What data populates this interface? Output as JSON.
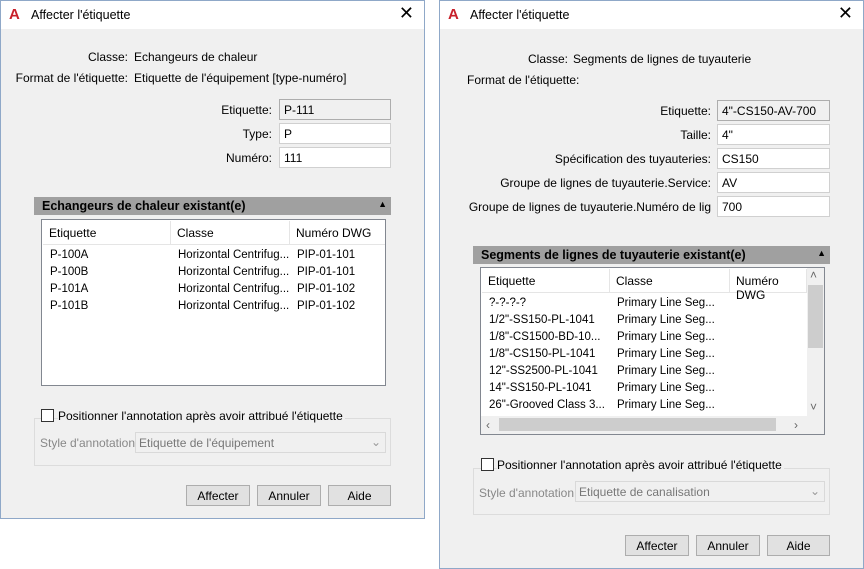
{
  "left": {
    "title": "Affecter l'étiquette",
    "classe_label": "Classe:",
    "classe_value": "Echangeurs de chaleur",
    "format_label": "Format de l'étiquette:",
    "format_value": "Etiquette de l'équipement [type-numéro]",
    "fields": [
      {
        "label": "Etiquette:",
        "value": "P-111",
        "readonly": true
      },
      {
        "label": "Type:",
        "value": "P"
      },
      {
        "label": "Numéro:",
        "value": "111"
      }
    ],
    "section": "Echangeurs de chaleur existant(e)",
    "columns": [
      "Etiquette",
      "Classe",
      "Numéro DWG"
    ],
    "rows": [
      [
        "P-100A",
        "Horizontal Centrifug...",
        "PIP-01-101"
      ],
      [
        "P-100B",
        "Horizontal Centrifug...",
        "PIP-01-101"
      ],
      [
        "P-101A",
        "Horizontal Centrifug...",
        "PIP-01-102"
      ],
      [
        "P-101B",
        "Horizontal Centrifug...",
        "PIP-01-102"
      ]
    ],
    "checkbox": "Positionner l'annotation après avoir attribué l'étiquette",
    "style_label": "Style d'annotation:",
    "style_value": "Etiquette de l'équipement",
    "buttons": [
      "Affecter",
      "Annuler",
      "Aide"
    ]
  },
  "right": {
    "title": "Affecter l'étiquette",
    "classe_label": "Classe:",
    "classe_value": "Segments de lignes de tuyauterie",
    "format_label": "Format de l'étiquette:",
    "fields": [
      {
        "label": "Etiquette:",
        "value": "4\"-CS150-AV-700",
        "readonly": true
      },
      {
        "label": "Taille:",
        "value": "4\""
      },
      {
        "label": "Spécification des tuyauteries:",
        "value": "CS150"
      },
      {
        "label": "Groupe de lignes de tuyauterie.Service:",
        "value": "AV"
      },
      {
        "label": "Groupe de lignes de tuyauterie.Numéro de lig",
        "value": "700"
      }
    ],
    "section": "Segments de lignes de tuyauterie existant(e)",
    "columns": [
      "Etiquette",
      "Classe",
      "Numéro DWG"
    ],
    "rows": [
      [
        "?-?-?-?",
        "Primary Line Seg..."
      ],
      [
        "1/2\"-SS150-PL-1041",
        "Primary Line Seg..."
      ],
      [
        "1/8\"-CS1500-BD-10...",
        "Primary Line Seg..."
      ],
      [
        "1/8\"-CS150-PL-1041",
        "Primary Line Seg..."
      ],
      [
        "12\"-SS2500-PL-1041",
        "Primary Line Seg..."
      ],
      [
        "14\"-SS150-PL-1041",
        "Primary Line Seg..."
      ],
      [
        "26\"-Grooved Class 3...",
        "Primary Line Seg..."
      ]
    ],
    "checkbox": "Positionner l'annotation après avoir attribué l'étiquette",
    "style_label": "Style d'annotation:",
    "style_value": "Etiquette de canalisation",
    "buttons": [
      "Affecter",
      "Annuler",
      "Aide"
    ]
  }
}
